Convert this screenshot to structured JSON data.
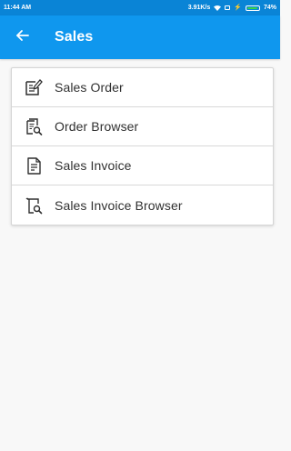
{
  "status_bar": {
    "time": "11:44 AM",
    "speed": "3.91K/s",
    "battery_percent": "74%",
    "battery_level": 0.74,
    "battery_color": "#37d24a"
  },
  "app_bar": {
    "title": "Sales",
    "background": "#0f97ee"
  },
  "menu": {
    "items": [
      {
        "label": "Sales Order",
        "icon": "edit-document-icon"
      },
      {
        "label": "Order Browser",
        "icon": "document-search-icon"
      },
      {
        "label": "Sales Invoice",
        "icon": "invoice-document-icon"
      },
      {
        "label": "Sales Invoice Browser",
        "icon": "receipt-search-icon"
      }
    ]
  }
}
